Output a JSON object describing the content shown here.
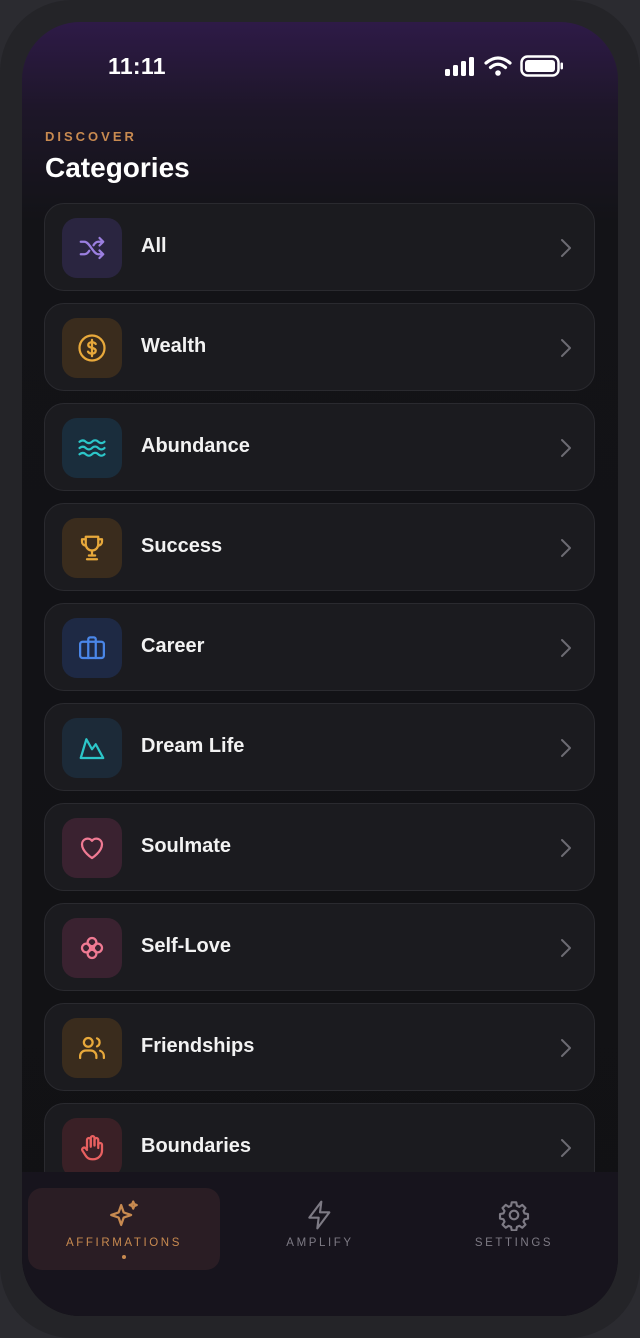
{
  "status_bar": {
    "time": "11:11"
  },
  "header": {
    "eyebrow": "DISCOVER",
    "title": "Categories"
  },
  "categories": [
    {
      "label": "All",
      "icon": "shuffle-icon",
      "color": "#9b7fe0",
      "bg": "#2a2540"
    },
    {
      "label": "Wealth",
      "icon": "dollar-coin-icon",
      "color": "#e8a93b",
      "bg": "#3a2c1d"
    },
    {
      "label": "Abundance",
      "icon": "waves-icon",
      "color": "#2cc6c9",
      "bg": "#1a2d3c"
    },
    {
      "label": "Success",
      "icon": "trophy-icon",
      "color": "#e8a93b",
      "bg": "#3a2c1d"
    },
    {
      "label": "Career",
      "icon": "briefcase-icon",
      "color": "#4a86e8",
      "bg": "#1e2944"
    },
    {
      "label": "Dream Life",
      "icon": "mountain-icon",
      "color": "#2cc6c9",
      "bg": "#1c2a38"
    },
    {
      "label": "Soulmate",
      "icon": "heart-icon",
      "color": "#f07a93",
      "bg": "#3a2230"
    },
    {
      "label": "Self-Love",
      "icon": "flower-icon",
      "color": "#f07a93",
      "bg": "#3a2230"
    },
    {
      "label": "Friendships",
      "icon": "users-icon",
      "color": "#e8a93b",
      "bg": "#3a2c1d"
    },
    {
      "label": "Boundaries",
      "icon": "hand-icon",
      "color": "#e86060",
      "bg": "#3a2026"
    }
  ],
  "tabs": [
    {
      "label": "AFFIRMATIONS",
      "icon": "sparkles-icon",
      "active": true
    },
    {
      "label": "AMPLIFY",
      "icon": "lightning-icon",
      "active": false
    },
    {
      "label": "SETTINGS",
      "icon": "gear-icon",
      "active": false
    }
  ],
  "colors": {
    "accent": "#c88a50",
    "row_bg": "#1b1b1f",
    "tab_inactive": "#7d7a84"
  }
}
